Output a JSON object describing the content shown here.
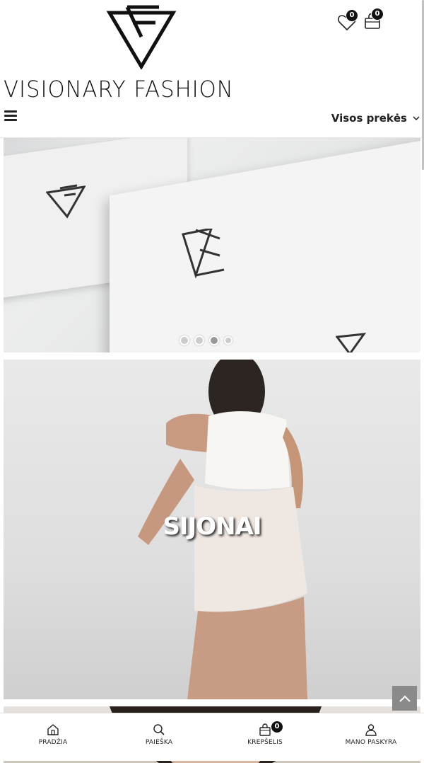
{
  "header": {
    "logo_text": "VISIONARY FASHION",
    "wishlist_count": "0",
    "cart_count": "0"
  },
  "nav": {
    "menu_icon": "hamburger-icon",
    "all_products_label": "Visos prekės",
    "dropdown_icon": "chevron-down-icon"
  },
  "slider": {
    "total_slides": 4,
    "active_slide": 3
  },
  "categories": [
    {
      "title": "SIJONAI"
    }
  ],
  "bottom_nav": {
    "items": [
      {
        "label": "PRADŽIA",
        "icon": "home-icon"
      },
      {
        "label": "PAIEŠKA",
        "icon": "search-icon"
      },
      {
        "label": "KREPŠELIS",
        "icon": "bag-icon",
        "badge": "0"
      },
      {
        "label": "MANO PASKYRA",
        "icon": "user-icon"
      }
    ]
  },
  "colors": {
    "text": "#222222",
    "badge_bg": "#111111",
    "back_to_top_bg": "#8a8a8a"
  }
}
